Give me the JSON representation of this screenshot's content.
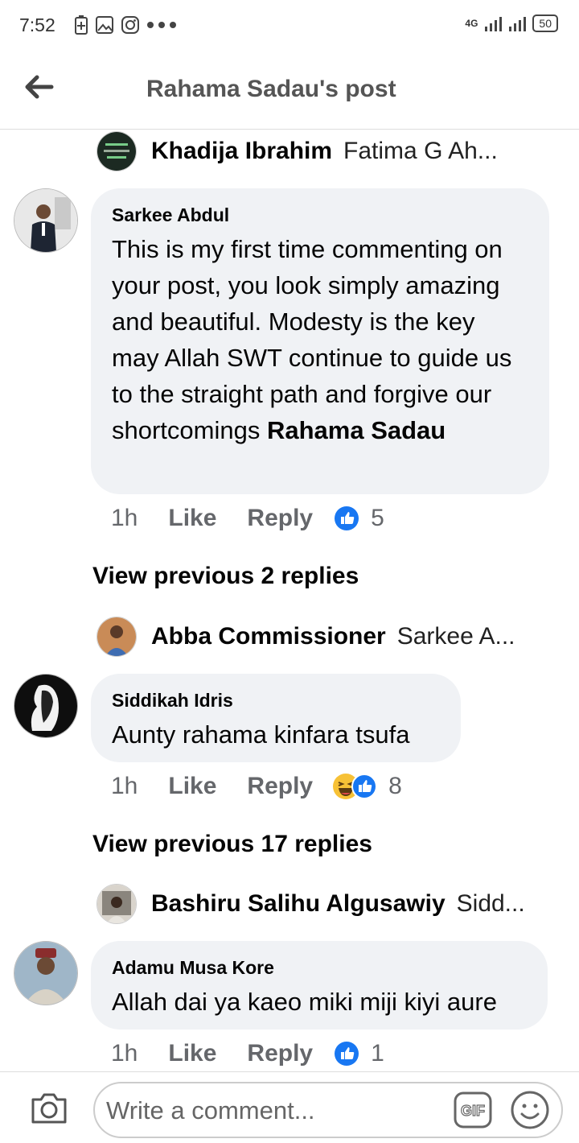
{
  "status_bar": {
    "time": "7:52",
    "network": "4G",
    "battery": "50"
  },
  "header": {
    "title": "Rahama Sadau's post"
  },
  "thread": [
    {
      "type": "reply_preview",
      "name": "Khadija Ibrahim",
      "preview": "Fatima G Ah..."
    },
    {
      "type": "comment",
      "author": "Sarkee Abdul",
      "text": "This is my first time commenting on your post, you look simply amazing and beautiful. Modesty is the key may Allah SWT continue to guide us to the straight path and forgive our shortcomings",
      "mention": "Rahama Sadau",
      "time": "1h",
      "like": "Like",
      "reply": "Reply",
      "reactions": "5"
    },
    {
      "type": "view_previous",
      "label": "View previous 2 replies"
    },
    {
      "type": "reply_preview",
      "name": "Abba Commissioner",
      "preview": "Sarkee A..."
    },
    {
      "type": "comment",
      "author": "Siddikah Idris",
      "text": "Aunty rahama kinfara tsufa",
      "time": "1h",
      "like": "Like",
      "reply": "Reply",
      "reactions": "8"
    },
    {
      "type": "view_previous",
      "label": "View previous 17 replies"
    },
    {
      "type": "reply_preview",
      "name": "Bashiru Salihu Algusawiy",
      "preview": "Sidd..."
    },
    {
      "type": "comment",
      "author": "Adamu Musa Kore",
      "text": "Allah dai ya kaeo miki miji kiyi aure",
      "time": "1h",
      "like": "Like",
      "reply": "Reply",
      "reactions": "1"
    }
  ],
  "composer": {
    "placeholder": "Write a comment...",
    "gif_label": "GIF"
  },
  "colors": {
    "like_blue": "#1877f2",
    "bubble": "#f0f2f5",
    "meta_gray": "#65676b"
  }
}
